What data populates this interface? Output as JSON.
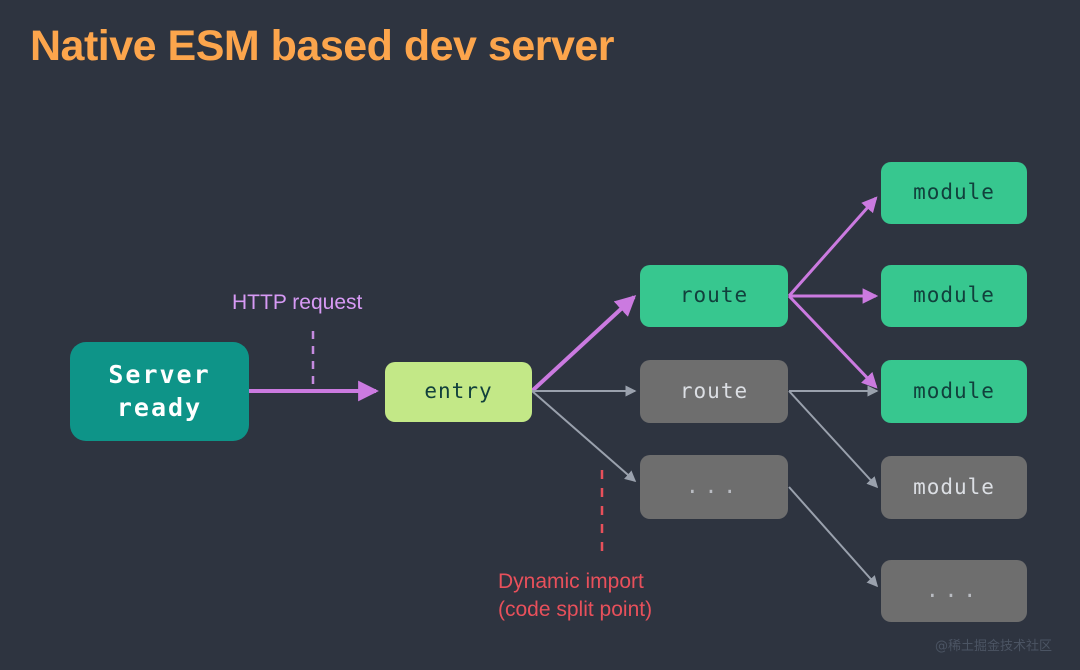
{
  "page": {
    "background": "#2e3440",
    "title": "Native ESM based dev server",
    "title_color": "#fca54c",
    "watermark": "@稀土掘金技术社区"
  },
  "palette": {
    "teal_solid": "#0e9488",
    "green_light": "#c3e887",
    "green_mid": "#37c78f",
    "gray_box": "#6e6e6e",
    "gray_text": "#dcdfe4",
    "dark_text": "#11403c",
    "purple": "#cb7ae0",
    "gray_arrow": "#9aa1ad",
    "red_dash": "#e8505b",
    "purple_dash": "#c58ae0"
  },
  "labels": {
    "http_request": "HTTP request",
    "dynamic_import_line1": "Dynamic import",
    "dynamic_import_line2": "(code split point)"
  },
  "nodes": {
    "server": {
      "text": "Server\nready",
      "fill": "#0e9488",
      "color": "#ffffff"
    },
    "entry": {
      "text": "entry",
      "fill": "#c3e887",
      "color": "#11403c"
    },
    "route_active": {
      "text": "route",
      "fill": "#37c78f",
      "color": "#11403c"
    },
    "route_inactive": {
      "text": "route",
      "fill": "#6e6e6e",
      "color": "#dcdfe4"
    },
    "route_dots": {
      "text": "...",
      "fill": "#6e6e6e",
      "color": "#b9bcc2"
    },
    "module_1": {
      "text": "module",
      "fill": "#37c78f",
      "color": "#11403c"
    },
    "module_2": {
      "text": "module",
      "fill": "#37c78f",
      "color": "#11403c"
    },
    "module_3": {
      "text": "module",
      "fill": "#37c78f",
      "color": "#11403c"
    },
    "module_4": {
      "text": "module",
      "fill": "#6e6e6e",
      "color": "#dcdfe4"
    },
    "module_dots": {
      "text": "...",
      "fill": "#6e6e6e",
      "color": "#b9bcc2"
    }
  }
}
